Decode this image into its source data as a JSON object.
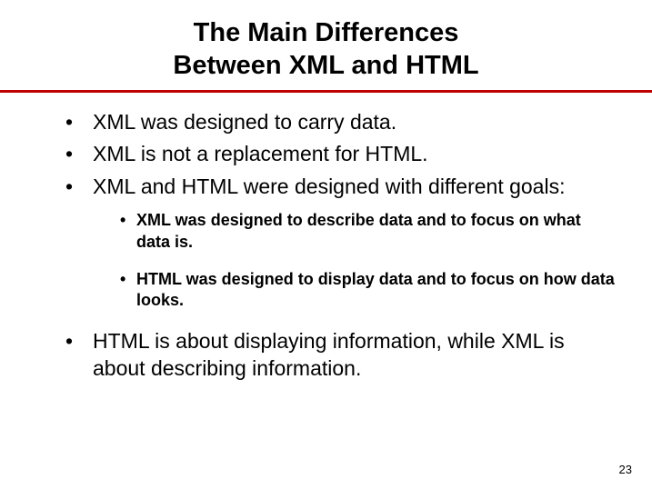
{
  "title_line1": "The Main Differences",
  "title_line2": "Between XML and HTML",
  "bullets": {
    "b1": "XML was designed to carry data.",
    "b2": "XML is not a replacement for HTML.",
    "b3": "XML and HTML were designed with different goals:",
    "b4": "HTML is about displaying information, while XML is about describing information."
  },
  "sub": {
    "s1": "XML was designed to describe data and to focus on what data is.",
    "s2": "HTML was designed to display data and to focus on how data looks."
  },
  "page_number": "23"
}
